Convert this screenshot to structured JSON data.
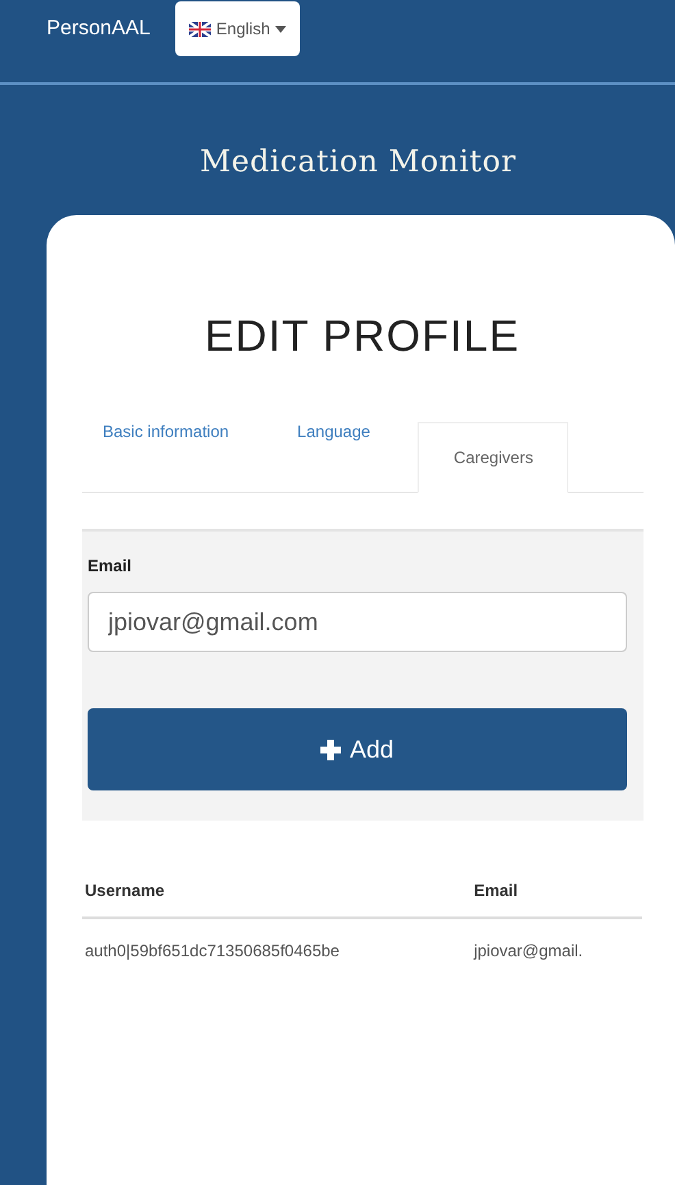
{
  "navbar": {
    "brand": "PersonAAL",
    "language": "English"
  },
  "title": "Medication Monitor",
  "heading": "EDIT PROFILE",
  "tabs": [
    {
      "label": "Basic information",
      "selected": false
    },
    {
      "label": "Language",
      "selected": false
    },
    {
      "label": "Caregivers",
      "selected": true
    }
  ],
  "form": {
    "label": "Email",
    "value": "jpiovar@gmail.com",
    "button": "Add"
  },
  "table": {
    "columns": [
      "Username",
      "Email"
    ],
    "rows": [
      [
        "auth0|59bf651dc71350685f0465be",
        "jpiovar@gmail."
      ]
    ]
  }
}
